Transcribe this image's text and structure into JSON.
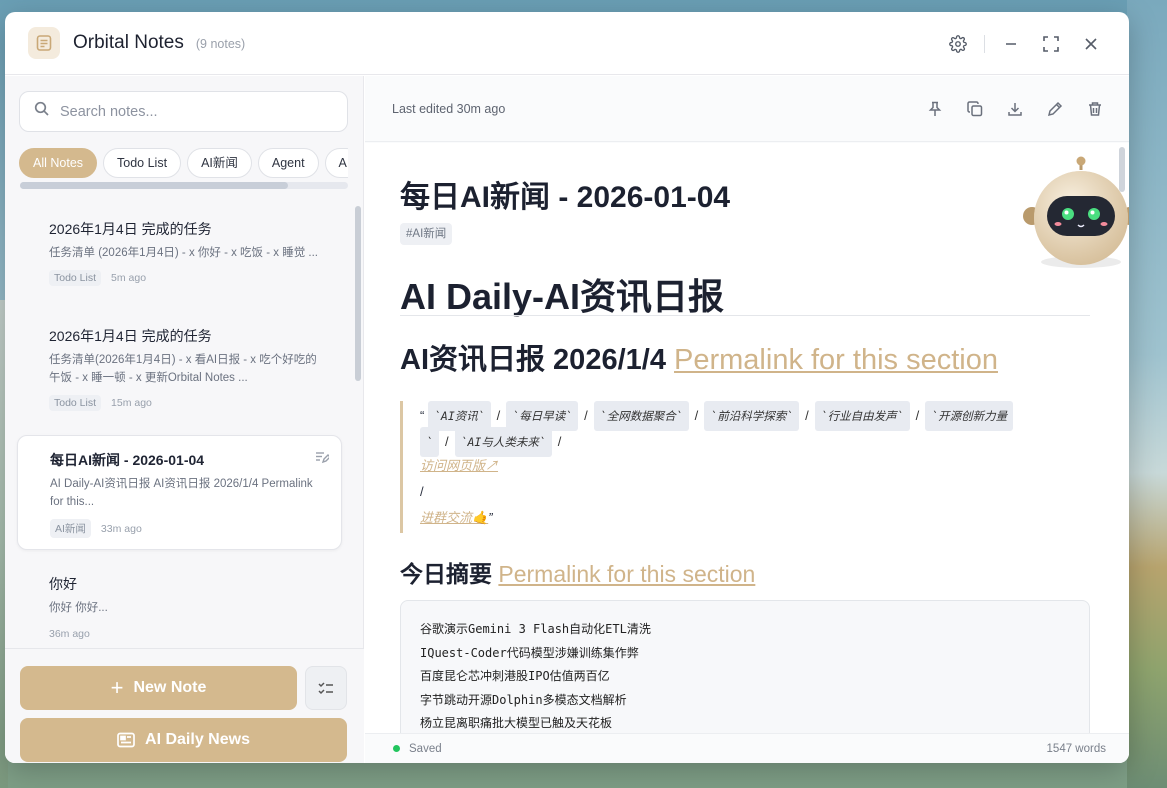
{
  "app": {
    "title": "Orbital Notes",
    "note_count": "(9 notes)"
  },
  "search": {
    "placeholder": "Search notes..."
  },
  "chips": [
    "All Notes",
    "Todo List",
    "AI新闻",
    "Agent",
    "A"
  ],
  "notes": [
    {
      "title": "2026年1月4日 完成的任务",
      "snippet": "任务清单 (2026年1月4日) - x 你好 - x 吃饭 - x 睡觉 ...",
      "tag": "Todo List",
      "time": "5m ago"
    },
    {
      "title": "2026年1月4日 完成的任务",
      "snippet": "任务清单(2026年1月4日) - x 看AI日报 - x 吃个好吃的午饭 - x 睡一顿 - x 更新Orbital Notes ...",
      "tag": "Todo List",
      "time": "15m ago"
    },
    {
      "title": "每日AI新闻 - 2026-01-04",
      "snippet": "AI Daily-AI资讯日报 AI资讯日报 2026/1/4 Permalink for this...",
      "tag": "AI新闻",
      "time": "33m ago"
    },
    {
      "title": "你好",
      "snippet": "你好 你好...",
      "tag": "",
      "time": "36m ago"
    }
  ],
  "buttons": {
    "new_note": "New Note",
    "ai_daily": "AI Daily News"
  },
  "editor": {
    "last_edited": "Last edited 30m ago",
    "title": "每日AI新闻 - 2026-01-04",
    "tag": "#AI新闻",
    "h1": "AI Daily-AI资讯日报",
    "h2_text": "AI资讯日报 2026/1/4",
    "permalink": "Permalink for this section",
    "bq_codes_line1": [
      "`AI资讯`",
      "`每日早读`",
      "`全网数据聚合`",
      "`前沿科学探索`",
      "`行业自由发声`",
      "`开源创新力量"
    ],
    "bq_codes_line2": [
      "`AI与人类未来`"
    ],
    "bq_open_quote": "“",
    "bq_line2_start": "`",
    "link_web": "访问网页版↗",
    "slash": "/",
    "link_group": "进群交流🤙",
    "bq_close_quote": "”",
    "h3_text": "今日摘要",
    "summary": [
      "谷歌演示Gemini 3 Flash自动化ETL清洗",
      "IQuest-Coder代码模型涉嫌训练集作弊",
      "百度昆仑芯冲刺港股IPO估值两百亿",
      "字节跳动开源Dolphin多模态文档解析",
      "杨立昆离职痛批大模型已触及天花板"
    ],
    "status": "Saved",
    "word_count": "1547 words"
  },
  "colors": {
    "accent": "#d4b98e",
    "saved": "#22c55e"
  }
}
